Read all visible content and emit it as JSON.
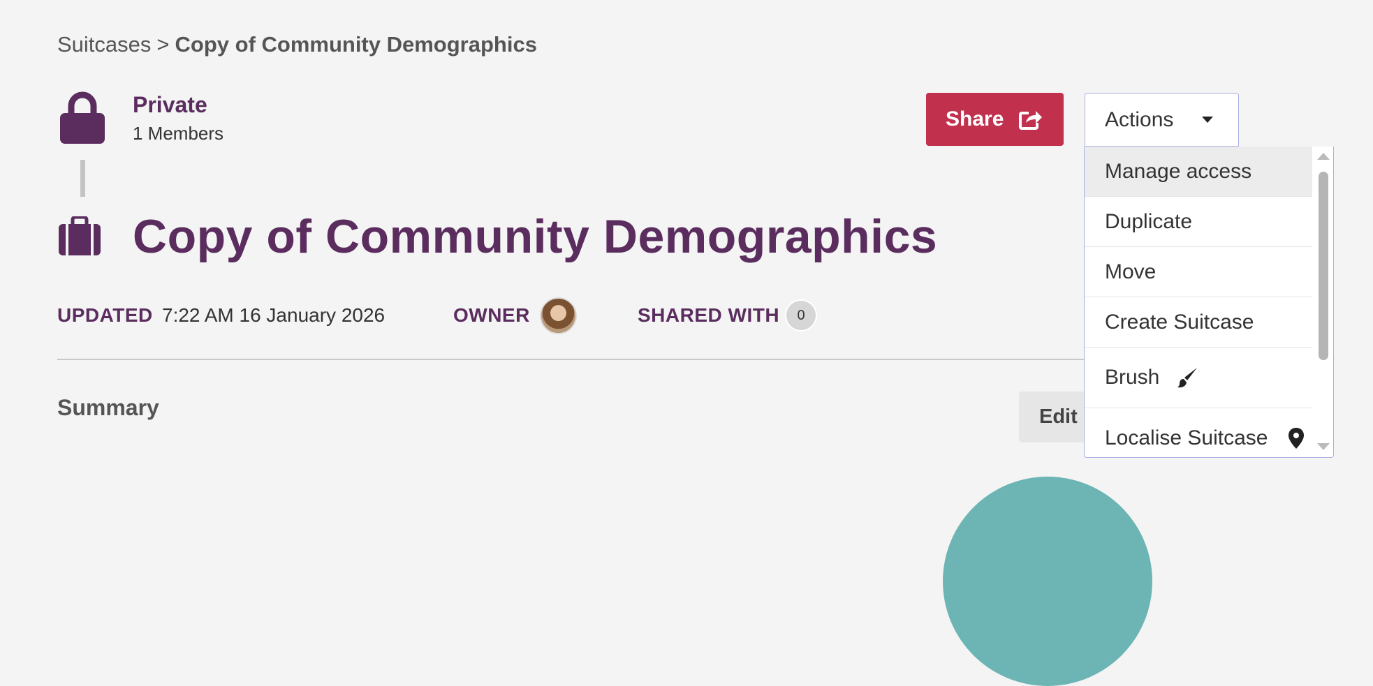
{
  "breadcrumb": {
    "parent": "Suitcases",
    "separator": ">",
    "current": "Copy of Community Demographics"
  },
  "privacy": {
    "label": "Private",
    "members": "1 Members",
    "icon": "lock-icon"
  },
  "title": "Copy of Community Demographics",
  "meta": {
    "updated_label": "UPDATED",
    "updated_value": "7:22 AM 16 January 2026",
    "owner_label": "OWNER",
    "shared_label": "SHARED WITH",
    "shared_count": "0"
  },
  "summary": {
    "title": "Summary",
    "edit_label": "Edit"
  },
  "share_button": {
    "label": "Share",
    "icon": "share-icon"
  },
  "actions": {
    "label": "Actions",
    "items": [
      {
        "label": "Manage access"
      },
      {
        "label": "Duplicate"
      },
      {
        "label": "Move"
      },
      {
        "label": "Create Suitcase"
      },
      {
        "label": "Brush",
        "icon": "brush-icon"
      },
      {
        "label": "Localise Suitcase",
        "icon": "map-pin-icon"
      }
    ]
  },
  "colors": {
    "brand_purple": "#5a2d5e",
    "share_red": "#c1304d",
    "background": "#f4f4f4",
    "accent_teal": "#6db5b5"
  }
}
